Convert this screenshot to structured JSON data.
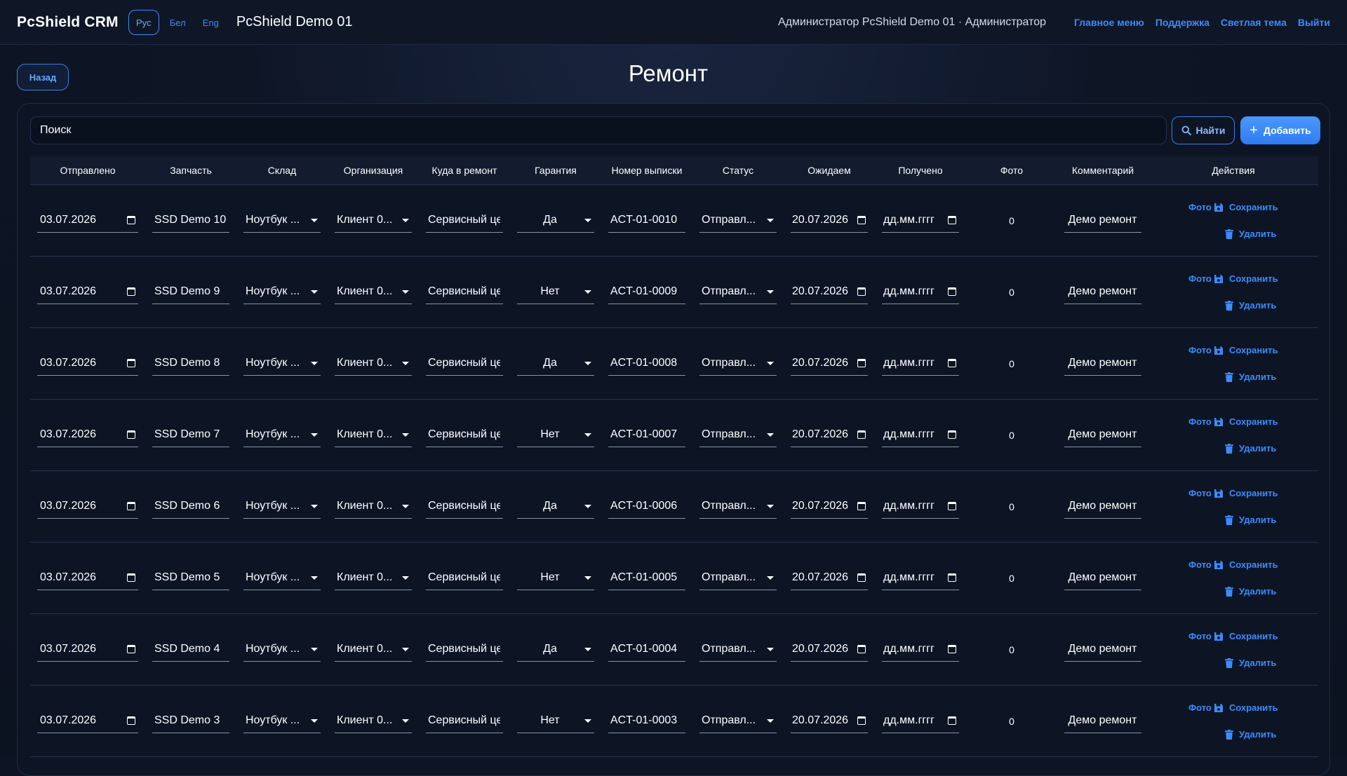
{
  "app": {
    "brand": "PcShield CRM",
    "languages": [
      "Рус",
      "Бел",
      "Eng"
    ],
    "active_language": "Рус",
    "demo_name": "PcShield Demo 01",
    "user": "Администратор PcShield Demo 01 · Администратор",
    "links": [
      "Главное меню",
      "Поддержка",
      "Светлая тема",
      "Выйти"
    ]
  },
  "page": {
    "back_label": "Назад",
    "title": "Ремонт"
  },
  "search": {
    "placeholder": "Поиск",
    "find_label": "Найти",
    "add_label": "Добавить"
  },
  "table": {
    "columns": [
      "Отправлено",
      "Запчасть",
      "Склад",
      "Организация",
      "Куда в ремонт",
      "Гарантия",
      "Номер выписки",
      "Статус",
      "Ожидаем",
      "Получено",
      "Фото",
      "Комментарий",
      "Действия"
    ],
    "action_labels": {
      "photo": "Фото",
      "save": "Сохранить",
      "delete": "Удалить"
    },
    "rows": [
      {
        "sent": "03.07.2026",
        "part": "SSD Demo 10",
        "warehouse": "Ноутбук ...",
        "org": "Клиент 0...",
        "destination": "Сервисный це",
        "warranty": "Да",
        "statement": "ACT-01-0010",
        "status": "Отправл...",
        "expected": "20.07.2026",
        "received": "дд.мм.гггг",
        "photos": "0",
        "comment": "Демо ремонт"
      },
      {
        "sent": "03.07.2026",
        "part": "SSD Demo 9",
        "warehouse": "Ноутбук ...",
        "org": "Клиент 0...",
        "destination": "Сервисный це",
        "warranty": "Нет",
        "statement": "ACT-01-0009",
        "status": "Отправл...",
        "expected": "20.07.2026",
        "received": "дд.мм.гггг",
        "photos": "0",
        "comment": "Демо ремонт"
      },
      {
        "sent": "03.07.2026",
        "part": "SSD Demo 8",
        "warehouse": "Ноутбук ...",
        "org": "Клиент 0...",
        "destination": "Сервисный це",
        "warranty": "Да",
        "statement": "ACT-01-0008",
        "status": "Отправл...",
        "expected": "20.07.2026",
        "received": "дд.мм.гггг",
        "photos": "0",
        "comment": "Демо ремонт"
      },
      {
        "sent": "03.07.2026",
        "part": "SSD Demo 7",
        "warehouse": "Ноутбук ...",
        "org": "Клиент 0...",
        "destination": "Сервисный це",
        "warranty": "Нет",
        "statement": "ACT-01-0007",
        "status": "Отправл...",
        "expected": "20.07.2026",
        "received": "дд.мм.гггг",
        "photos": "0",
        "comment": "Демо ремонт"
      },
      {
        "sent": "03.07.2026",
        "part": "SSD Demo 6",
        "warehouse": "Ноутбук ...",
        "org": "Клиент 0...",
        "destination": "Сервисный це",
        "warranty": "Да",
        "statement": "ACT-01-0006",
        "status": "Отправл...",
        "expected": "20.07.2026",
        "received": "дд.мм.гггг",
        "photos": "0",
        "comment": "Демо ремонт"
      },
      {
        "sent": "03.07.2026",
        "part": "SSD Demo 5",
        "warehouse": "Ноутбук ...",
        "org": "Клиент 0...",
        "destination": "Сервисный це",
        "warranty": "Нет",
        "statement": "ACT-01-0005",
        "status": "Отправл...",
        "expected": "20.07.2026",
        "received": "дд.мм.гггг",
        "photos": "0",
        "comment": "Демо ремонт"
      },
      {
        "sent": "03.07.2026",
        "part": "SSD Demo 4",
        "warehouse": "Ноутбук ...",
        "org": "Клиент 0...",
        "destination": "Сервисный це",
        "warranty": "Да",
        "statement": "ACT-01-0004",
        "status": "Отправл...",
        "expected": "20.07.2026",
        "received": "дд.мм.гггг",
        "photos": "0",
        "comment": "Демо ремонт"
      },
      {
        "sent": "03.07.2026",
        "part": "SSD Demo 3",
        "warehouse": "Ноутбук ...",
        "org": "Клиент 0...",
        "destination": "Сервисный це",
        "warranty": "Нет",
        "statement": "ACT-01-0003",
        "status": "Отправл...",
        "expected": "20.07.2026",
        "received": "дд.мм.гггг",
        "photos": "0",
        "comment": "Демо ремонт"
      }
    ]
  },
  "icons": {
    "search": "search-icon",
    "plus": "plus-icon",
    "calendar": "calendar-icon",
    "dropdown": "chevron-down-icon",
    "save": "floppy-disk-icon",
    "delete": "trash-icon"
  },
  "colors": {
    "accent": "#3d8bff",
    "background": "#0b1220",
    "card": "#0d1524"
  }
}
